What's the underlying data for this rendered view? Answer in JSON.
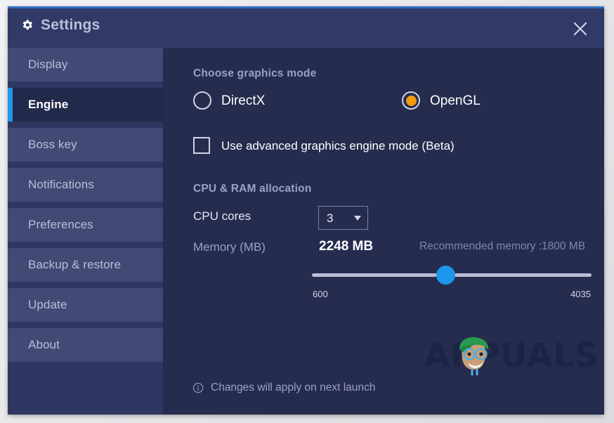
{
  "window": {
    "title": "Settings",
    "title_icon": "gear-icon",
    "close_icon": "close-icon"
  },
  "sidebar": {
    "items": [
      {
        "label": "Display",
        "active": false
      },
      {
        "label": "Engine",
        "active": true
      },
      {
        "label": "Boss key",
        "active": false
      },
      {
        "label": "Notifications",
        "active": false
      },
      {
        "label": "Preferences",
        "active": false
      },
      {
        "label": "Backup & restore",
        "active": false
      },
      {
        "label": "Update",
        "active": false
      },
      {
        "label": "About",
        "active": false
      }
    ]
  },
  "content": {
    "graphics": {
      "section_title": "Choose graphics mode",
      "options": [
        {
          "label": "DirectX",
          "selected": false
        },
        {
          "label": "OpenGL",
          "selected": true
        }
      ],
      "advanced_checkbox": {
        "label": "Use advanced graphics engine mode (Beta)",
        "checked": false
      }
    },
    "allocation": {
      "section_title": "CPU & RAM allocation",
      "cpu_cores": {
        "label": "CPU cores",
        "value": "3",
        "caret_icon": "chevron-down-icon"
      },
      "memory": {
        "label": "Memory (MB)",
        "value": "2248 MB",
        "recommendation": "Recommended memory :1800 MB",
        "slider": {
          "min_label": "600",
          "max_label": "4035",
          "min": 600,
          "max": 4035,
          "value": 2248
        }
      }
    },
    "footer": {
      "info_icon": "info-circle-icon",
      "note": "Changes will apply on next launch"
    },
    "watermark": {
      "text": "APPUALS"
    }
  },
  "colors": {
    "window_bg": "#262c4e",
    "titlebar_bg": "#313a66",
    "sidebar_bg": "#2e3761",
    "nav_item_bg": "#414a75",
    "nav_active_bg": "#222a4b",
    "accent_blue": "#2196f3",
    "radio_orange": "#f59b0c",
    "slider_blue": "#1e96ec",
    "top_border": "#2f6fbf"
  }
}
